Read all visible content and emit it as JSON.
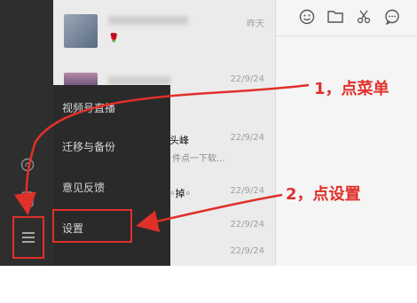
{
  "sidebar": {
    "icons": [
      "miniprogram-icon",
      "phone-icon"
    ]
  },
  "chat_list": {
    "items": [
      {
        "time": "昨天",
        "snippet": "🌹"
      },
      {
        "time": "22/9/24",
        "snippet": ""
      },
      {
        "time": "22/9/24",
        "title": "直头峰",
        "snippet": "件点一下软..."
      },
      {
        "time": "22/9/24",
        "title": "征◦掉◦",
        "snippet": ""
      },
      {
        "time": "22/9/24",
        "snippet": ""
      },
      {
        "time": "22/9/24",
        "snippet": ""
      }
    ]
  },
  "toolbar": {
    "icons": [
      "emoji-icon",
      "folder-icon",
      "scissors-icon",
      "chat-bubble-icon"
    ]
  },
  "menu": {
    "items": [
      {
        "label": "视频号直播"
      },
      {
        "label": "迁移与备份"
      },
      {
        "label": "意见反馈"
      },
      {
        "label": "设置"
      }
    ]
  },
  "annotations": {
    "step1": "1，点菜单",
    "step2": "2，点设置"
  },
  "colors": {
    "annotation": "#e0302a",
    "sidebar": "#2e2e2e",
    "menu": "#2a2a2a"
  }
}
